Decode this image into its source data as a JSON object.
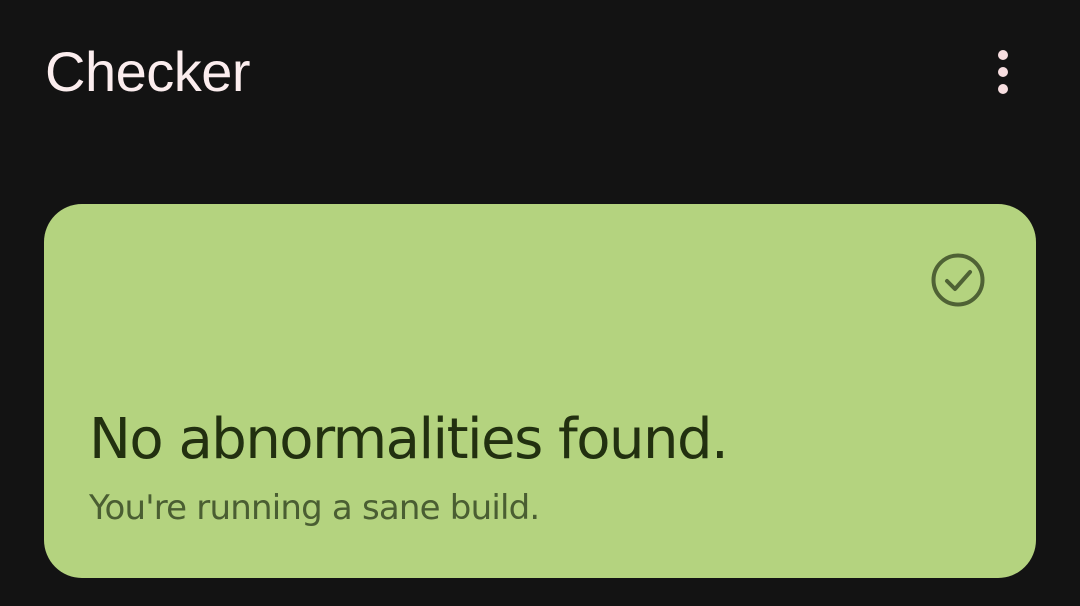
{
  "app_bar": {
    "title": "Checker",
    "overflow_icon": "more-vert-icon"
  },
  "status_card": {
    "title": "No abnormalities found.",
    "subtitle": "You're running a sane build.",
    "icon": "check-circle-icon"
  },
  "colors": {
    "background": "#131313",
    "app_title": "#FBEDEE",
    "overflow_icon": "#F7DEE0",
    "card_background": "#B4D37F",
    "card_title": "#223010",
    "card_subtitle": "#4A5E32",
    "card_icon": "#4F6235"
  }
}
